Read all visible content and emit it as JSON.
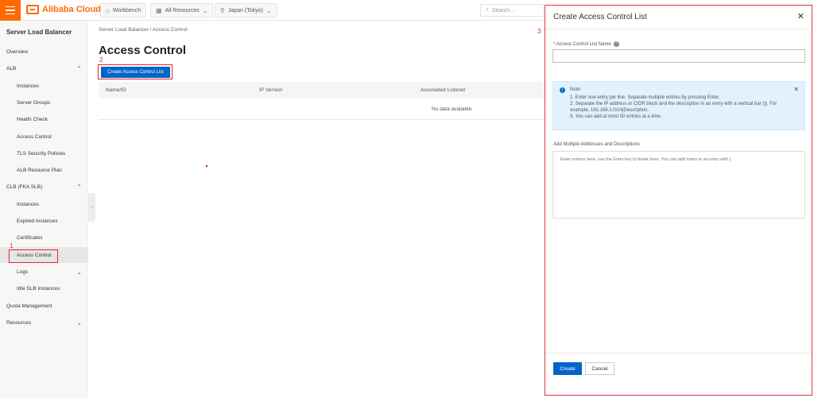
{
  "topbar": {
    "brand": "Alibaba Cloud",
    "workbench": "Workbench",
    "resources": "All Resources",
    "region": "Japan (Tokyo)",
    "search_placeholder": "Search..."
  },
  "sidebar": {
    "title": "Server Load Balancer",
    "items": [
      {
        "label": "Overview",
        "level": 0
      },
      {
        "label": "ALB",
        "level": 0,
        "chevron": "up"
      },
      {
        "label": "Instances",
        "level": 1
      },
      {
        "label": "Server Groups",
        "level": 1
      },
      {
        "label": "Health Check",
        "level": 1
      },
      {
        "label": "Access Control",
        "level": 1
      },
      {
        "label": "TLS Security Policies",
        "level": 1
      },
      {
        "label": "ALB Resource Plan",
        "level": 1
      },
      {
        "label": "CLB (FKA SLB)",
        "level": 0,
        "chevron": "up"
      },
      {
        "label": "Instances",
        "level": 1
      },
      {
        "label": "Expired Instances",
        "level": 1
      },
      {
        "label": "Certificates",
        "level": 1
      },
      {
        "label": "Access Control",
        "level": 1,
        "active": true
      },
      {
        "label": "Logs",
        "level": 1,
        "chevron": "down"
      },
      {
        "label": "Idle SLB Instances",
        "level": 1
      },
      {
        "label": "Quota Management",
        "level": 0
      },
      {
        "label": "Resources",
        "level": 0,
        "chevron": "down"
      }
    ]
  },
  "main": {
    "breadcrumb": "Server Load Balancer  /  Access Control",
    "title": "Access Control",
    "create_button": "Create Access Control List",
    "columns": [
      "Name/ID",
      "IP Version",
      "Associated Listener"
    ],
    "empty_text": "No data available."
  },
  "annotations": [
    "1",
    "2",
    "3"
  ],
  "panel": {
    "title": "Create Access Control List",
    "name_label": "* Access Control List Name",
    "name_value": "",
    "note": {
      "title": "Note:",
      "lines": [
        "1. Enter one entry per line. Separate multiple entries by pressing Enter.",
        "2. Separate the IP address or CIDR block and the description in an entry with a vertical bar (|). For",
        "example, 192.168.1.0/24|Description.",
        "3. You can add at most 50 entries at a time."
      ]
    },
    "multi_label": "Add Multiple Addresses and Descriptions",
    "multi_placeholder": "Enter entries here, use the Enter key to break lines. You can add notes to an entry with |.",
    "create": "Create",
    "cancel": "Cancel"
  },
  "colors": {
    "brand": "#ff6a00",
    "primary": "#0064c8",
    "annotation": "#e0282e",
    "note_bg": "#e1f1fd"
  }
}
